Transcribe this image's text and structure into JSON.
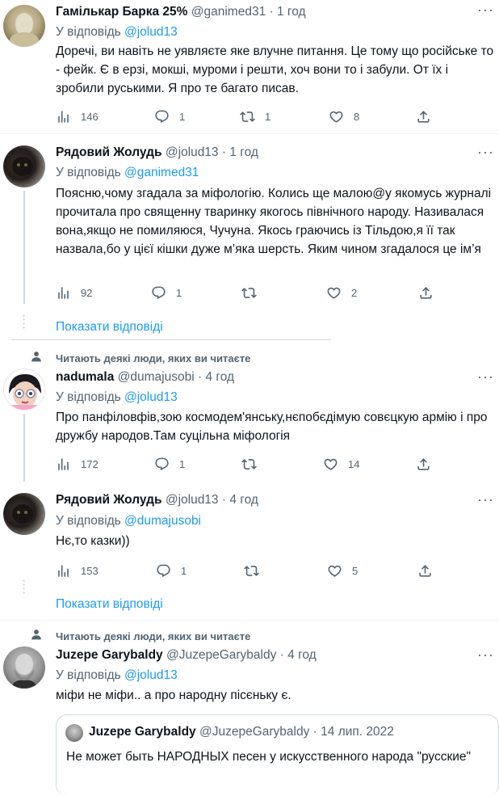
{
  "common": {
    "dot": "·",
    "more": "···",
    "reply_prefix": "У відповідь",
    "show_replies": "Показати відповіді",
    "social_context": "Читають деякі люди, яких ви читаєте"
  },
  "tweets": [
    {
      "name": "Гамількар Барка 25%",
      "handle": "@ganimed31",
      "time": "1 год",
      "reply_to": "@jolud13",
      "text": "Доречі, ви навіть не уявляєте яке влучне питання. Це тому що російське то - фейк. Є в ерзі, мокші, муроми і решти, хоч вони то і забули. От їх і зробили руськими. Я про те багато писав.",
      "views": "146",
      "replies": "1",
      "retweets": "1",
      "likes": "8"
    },
    {
      "name": "Рядовий Жолудь",
      "handle": "@jolud13",
      "time": "1 год",
      "reply_to": "@ganimed31",
      "text": "Поясню,чому згадала за міфологію. Колись ще малою@у якомусь журналі прочитала про священну тваринку якогось північного народу. Називалася вона,якщо не помиляюся, Чучуна. Якось граючись із Тільдою,я її так назвала,бо у цієї кішки дуже м’яка шерсть. Яким чином згадалося це ім’я",
      "views": "92",
      "replies": "1",
      "retweets": "",
      "likes": "2"
    },
    {
      "name": "nadumala",
      "handle": "@dumajusobi",
      "time": "4 год",
      "reply_to": "@jolud13",
      "text": "Про панфіловфів,зою космодем'янську,нєпобєдімую совєцкую армію і про дружбу народов.Там суцільна міфологія",
      "views": "172",
      "replies": "1",
      "retweets": "",
      "likes": "14"
    },
    {
      "name": "Рядовий Жолудь",
      "handle": "@jolud13",
      "time": "4 год",
      "reply_to": "@dumajusobi",
      "text": "Нє,то казки))",
      "views": "153",
      "replies": "1",
      "retweets": "",
      "likes": "5"
    },
    {
      "name": "Juzepe Garybaldy",
      "handle": "@JuzepeGarybaldy",
      "time": "4 год",
      "reply_to": "@jolud13",
      "text": "міфи не міфи.. а про народну пісєньку є."
    }
  ],
  "quote": {
    "name": "Juzepe Garybaldy",
    "handle": "@JuzepeGarybaldy",
    "date": "14 лип. 2022",
    "text": "Не может быть НАРОДНЫХ песен у искусственного народа \"русские\""
  },
  "colors": {
    "accent": "#1d9bf0",
    "secondary": "#536471",
    "text": "#0f1419",
    "border": "#eff3f4",
    "thread": "#cfd9de"
  },
  "icons": [
    "views-icon",
    "reply-icon",
    "retweet-icon",
    "like-icon",
    "share-icon",
    "person-icon",
    "more-icon"
  ]
}
